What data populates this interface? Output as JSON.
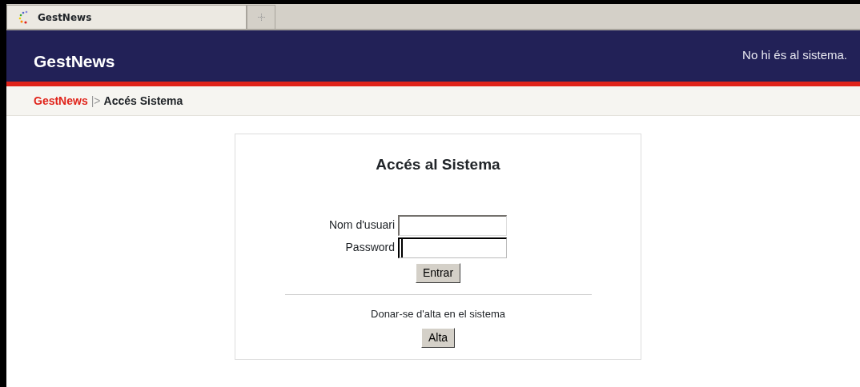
{
  "browser_tab": {
    "title": "GestNews",
    "selected": true
  },
  "header": {
    "site_title": "GestNews",
    "status": "No hi és al sistema."
  },
  "breadcrumb": [
    {
      "label": "GestNews",
      "kind": "link"
    },
    {
      "label": "|>",
      "kind": "separator"
    },
    {
      "label": "Accés Sistema",
      "kind": "current"
    }
  ],
  "login": {
    "title": "Accés al Sistema",
    "fields": [
      {
        "label": "Nom d'usuari",
        "focused": false
      },
      {
        "label": "Password",
        "focused": true
      }
    ],
    "submit": "Entrar",
    "signup_text": "Donar-se d'alta en el sistema",
    "signup_button": "Alta"
  }
}
